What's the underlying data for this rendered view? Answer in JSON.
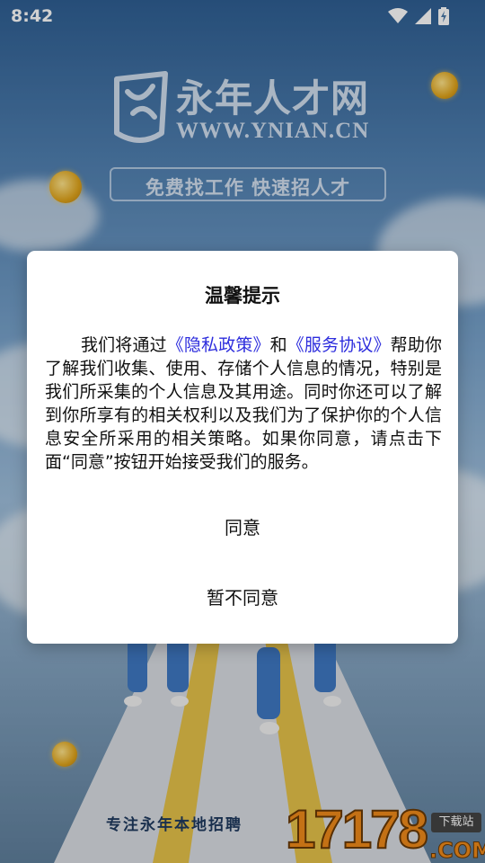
{
  "status_bar": {
    "time": "8:42",
    "icons": [
      "wifi-icon",
      "cellular-signal-icon",
      "battery-charging-icon"
    ]
  },
  "background": {
    "logo_name": "永年人才网",
    "logo_url": "WWW.YNIAN.CN",
    "slogan": "免费找工作 快速招人才",
    "bottom_tagline": "专注永年本地招聘",
    "watermark_number": "17178",
    "watermark_tag": "下载站",
    "watermark_domain": ".COM"
  },
  "dialog": {
    "title": "温馨提示",
    "body_part1": "我们将通过",
    "privacy_link": "《隐私政策》",
    "body_part2": "和",
    "service_link": "《服务协议》",
    "body_part3": "帮助你了解我们收集、使用、存储个人信息的情况，特别是我们所采集的个人信息及其用途。同时你还可以了解到你所享有的相关权利以及我们为了保护你的个人信息安全所采用的相关策略。如果你同意，请点击下面“同意”按钮开始接受我们的服务。",
    "agree_label": "同意",
    "disagree_label": "暂不同意"
  },
  "colors": {
    "link": "#2d2ddd",
    "watermark_orange": "#f08a1a"
  }
}
